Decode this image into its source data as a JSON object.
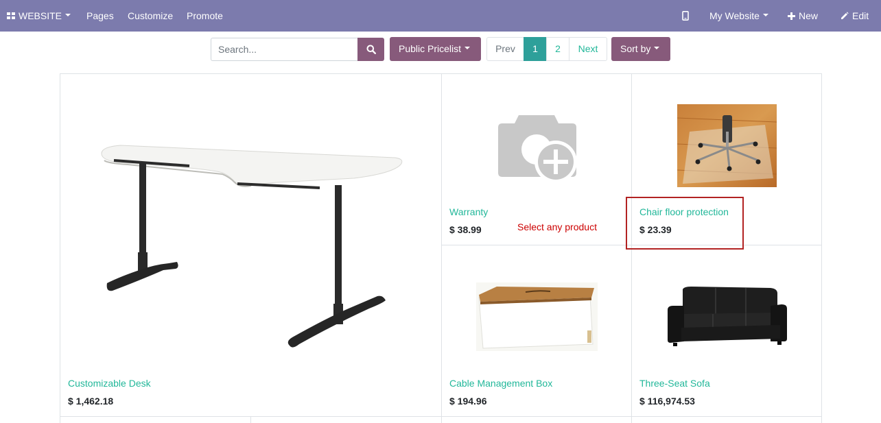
{
  "topbar": {
    "website_label": "WEBSITE",
    "menu": [
      "Pages",
      "Customize",
      "Promote"
    ],
    "my_website_label": "My Website",
    "new_label": "New",
    "edit_label": "Edit",
    "mobile_icon": "mobile-phone-icon",
    "apps_icon": "apps-grid-icon",
    "new_icon": "plus-icon",
    "edit_icon": "pencil-icon"
  },
  "search": {
    "placeholder": "Search...",
    "value": "",
    "button_icon": "search-icon"
  },
  "pricelist": {
    "label": "Public Pricelist"
  },
  "pager": {
    "prev": "Prev",
    "pages": [
      "1",
      "2"
    ],
    "active_page": "1",
    "next": "Next"
  },
  "sort": {
    "label": "Sort by"
  },
  "products": [
    {
      "name": "Customizable Desk",
      "price": "$ 1,462.18",
      "image": "desk-image"
    },
    {
      "name": "Warranty",
      "price": "$ 38.99",
      "image": "camera-placeholder-icon"
    },
    {
      "name": "Chair floor protection",
      "price": "$ 23.39",
      "image": "chair-mat-image"
    },
    {
      "name": "Cable Management Box",
      "price": "$ 194.96",
      "image": "cable-box-image"
    },
    {
      "name": "Three-Seat Sofa",
      "price": "$ 116,974.53",
      "image": "sofa-image"
    }
  ],
  "annotation": {
    "text": "Select any product",
    "color": "#cc0000"
  },
  "colors": {
    "topbar": "#7c7bad",
    "primary_button": "#875a7b",
    "link": "#21b799",
    "pager_active": "#2ea09a"
  }
}
